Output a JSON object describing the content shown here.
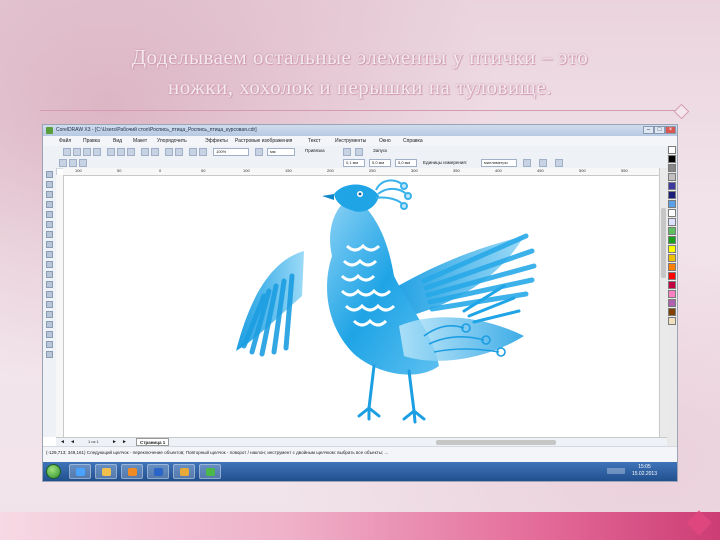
{
  "slide": {
    "title_line1": "Доделываем остальные элементы у птички – это",
    "title_line2": "ножки, хохолок и перышки на туловище."
  },
  "app": {
    "window_title": "CorelDRAW X3 - [C:\\Users\\Рабочий стол\\Роспись_птица_Роспись_птица_курсовая.cdr]",
    "menu": [
      "Файл",
      "Правка",
      "Вид",
      "Макет",
      "Упорядочить",
      "Эффекты",
      "Растровые изображения",
      "Текст",
      "Инструменты",
      "Окно",
      "Справка"
    ],
    "toolbar": {
      "zoom": "100%",
      "units": "мм",
      "snap_label": "Привязка",
      "launch_label": "Запуск"
    },
    "propbar": {
      "nudge": "0,1 мм",
      "x": "5,0 мм",
      "y": "5,0 мм",
      "units_label": "Единицы измерения:",
      "units_value": "миллиметры"
    },
    "ruler_top": [
      "100",
      "50",
      "0",
      "50",
      "100",
      "150",
      "200",
      "250",
      "300",
      "350",
      "400",
      "450",
      "500",
      "550"
    ],
    "page_bar": {
      "page_count": "1 из 1",
      "page_tab": "Страница 1"
    },
    "status": {
      "line1": "(-129,713; 349,161)   Следующий щелчок - переключение объектов; Повторный щелчок - поворот / наклон; инструмент с двойным щелчком: выбрать все объекты; ..."
    },
    "taskbar": {
      "time": "15:05",
      "date": "15.02.2013"
    }
  },
  "colors": {
    "bird_main": "#1fa4e6",
    "bird_light": "#bfe6fa",
    "palette": [
      "#ffffff",
      "#000000",
      "#888888",
      "#c0c0c0",
      "#3a3aa0",
      "#1c1c7a",
      "#5aa0e6",
      "#ffffff",
      "#e0e0ff",
      "#60c060",
      "#1aa01a",
      "#ffff00",
      "#f0c000",
      "#ff8000",
      "#ff0000",
      "#c00040",
      "#ff80c0",
      "#b060b0",
      "#804000",
      "#f0e0c0"
    ]
  }
}
